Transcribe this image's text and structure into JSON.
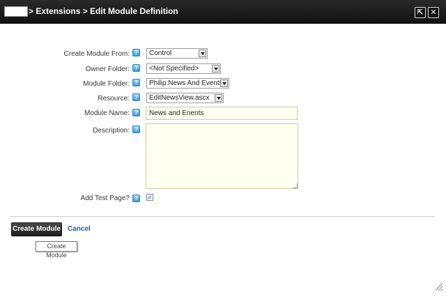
{
  "window": {
    "title": "> Extensions > Edit Module Definition",
    "maximize_icon": "maximize-icon",
    "close_icon": "close-icon",
    "maximize_glyph": "⇱",
    "close_glyph": "✕"
  },
  "form": {
    "help_glyph": "?",
    "fields": {
      "create_from": {
        "label": "Create Module From:",
        "value": "Control"
      },
      "owner_folder": {
        "label": "Owner Folder:",
        "value": "<Not Specified>"
      },
      "module_folder": {
        "label": "Module Folder:",
        "value": "Philip.News And Events"
      },
      "resource": {
        "label": "Resource:",
        "value": "EditNewsView.ascx"
      },
      "module_name": {
        "label": "Module Name:",
        "value": "News and Enents"
      },
      "description": {
        "label": "Description:",
        "value": ""
      },
      "add_test_page": {
        "label": "Add Test Page?",
        "checked": true,
        "check_glyph": "✓"
      }
    }
  },
  "actions": {
    "create_label": "Create Module",
    "cancel_label": "Cancel",
    "tooltip": "Create Module"
  }
}
